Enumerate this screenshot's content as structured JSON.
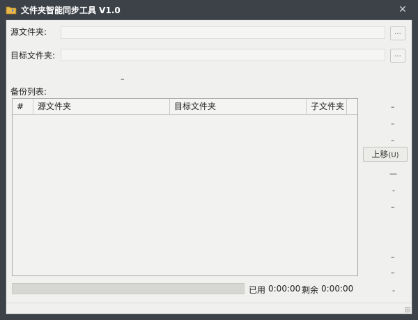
{
  "window": {
    "title": "文件夹智能同步工具 V1.0",
    "close_glyph": "✕",
    "icon": "folder-sync-icon"
  },
  "form": {
    "source_label": "源文件夹:",
    "source_value": "",
    "source_browse": "...",
    "target_label": "目标文件夹:",
    "target_value": "",
    "target_browse": "...",
    "status_dash": "–"
  },
  "backup_list": {
    "label": "备份列表:",
    "columns": [
      "#",
      "源文件夹",
      "目标文件夹",
      "子文件夹"
    ],
    "rows": []
  },
  "side_buttons": {
    "dashes_top": [
      "–",
      "–",
      "–"
    ],
    "move_up_label": "上移",
    "move_up_accel": "(U)",
    "dashes_bottom": [
      "—",
      "-",
      "–",
      "–",
      "–",
      "-"
    ]
  },
  "progress": {
    "fraction": 0,
    "used_label": "已用",
    "used_time": "0:00:00",
    "remaining_label": "剩余",
    "remaining_time": "0:00:00"
  },
  "colors": {
    "titlebar": "#3d4249",
    "client_bg": "#f0f0ef"
  }
}
